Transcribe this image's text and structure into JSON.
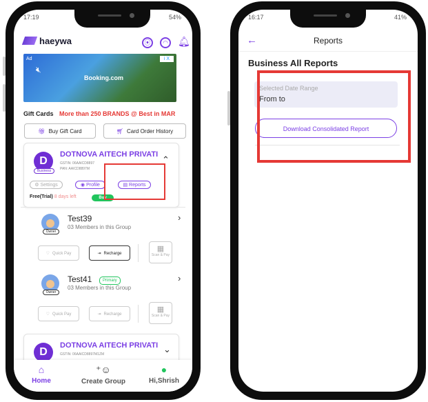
{
  "left": {
    "status_time": "17:19",
    "status_battery": "54%",
    "app_name": "haeywa",
    "ad": {
      "badge": "Ad",
      "brand": "Booking.com",
      "close": "i X"
    },
    "gift_cards_label": "Gift Cards",
    "ticker_text": "More than 250 BRANDS @ Best in MAR",
    "buy_gift_card": "Buy Gift Card",
    "card_order_history": "Card Order History",
    "business_card": {
      "avatar_letter": "D",
      "tag": "Business",
      "name": "DOTNOVA AITECH PRIVATI",
      "gstin": "GSTIN: 06AAICD8897",
      "pan": "PAN: AAICD8897M",
      "settings": "Settings",
      "profile": "Profile",
      "reports": "Reports",
      "trial": "Free(Trial)",
      "days_left": "8 days left",
      "buy": "Buy"
    },
    "groups": [
      {
        "name": "Test39",
        "subtitle": "03 Members in this Group",
        "owner": "Owner",
        "primary": "",
        "quick_pay": "Quick Pay",
        "recharge": "Recharge",
        "scan_pay": "Scan & Pay"
      },
      {
        "name": "Test41",
        "subtitle": "03 Members in this Group",
        "owner": "Owner",
        "primary": "Primary",
        "quick_pay": "Quick Pay",
        "recharge": "Recharge",
        "scan_pay": "Scan & Pay"
      }
    ],
    "business_card_2": {
      "avatar_letter": "D",
      "name": "DOTNOVA AITECH PRIVATI",
      "gstin": "GSTIN: 06AAICD8897M1ZM"
    },
    "nav": {
      "home": "Home",
      "create_group": "Create Group",
      "profile": "Hi,Shrish"
    }
  },
  "right": {
    "status_time": "16:17",
    "status_battery": "41%",
    "title": "Reports",
    "section_title": "Business All Reports",
    "date_range_placeholder": "Selected Date Range",
    "date_range_value": "From  to",
    "download_button": "Download Consolidated Report"
  },
  "colors": {
    "accent": "#7b3fe4",
    "highlight": "#e53935",
    "success": "#21c55d"
  }
}
